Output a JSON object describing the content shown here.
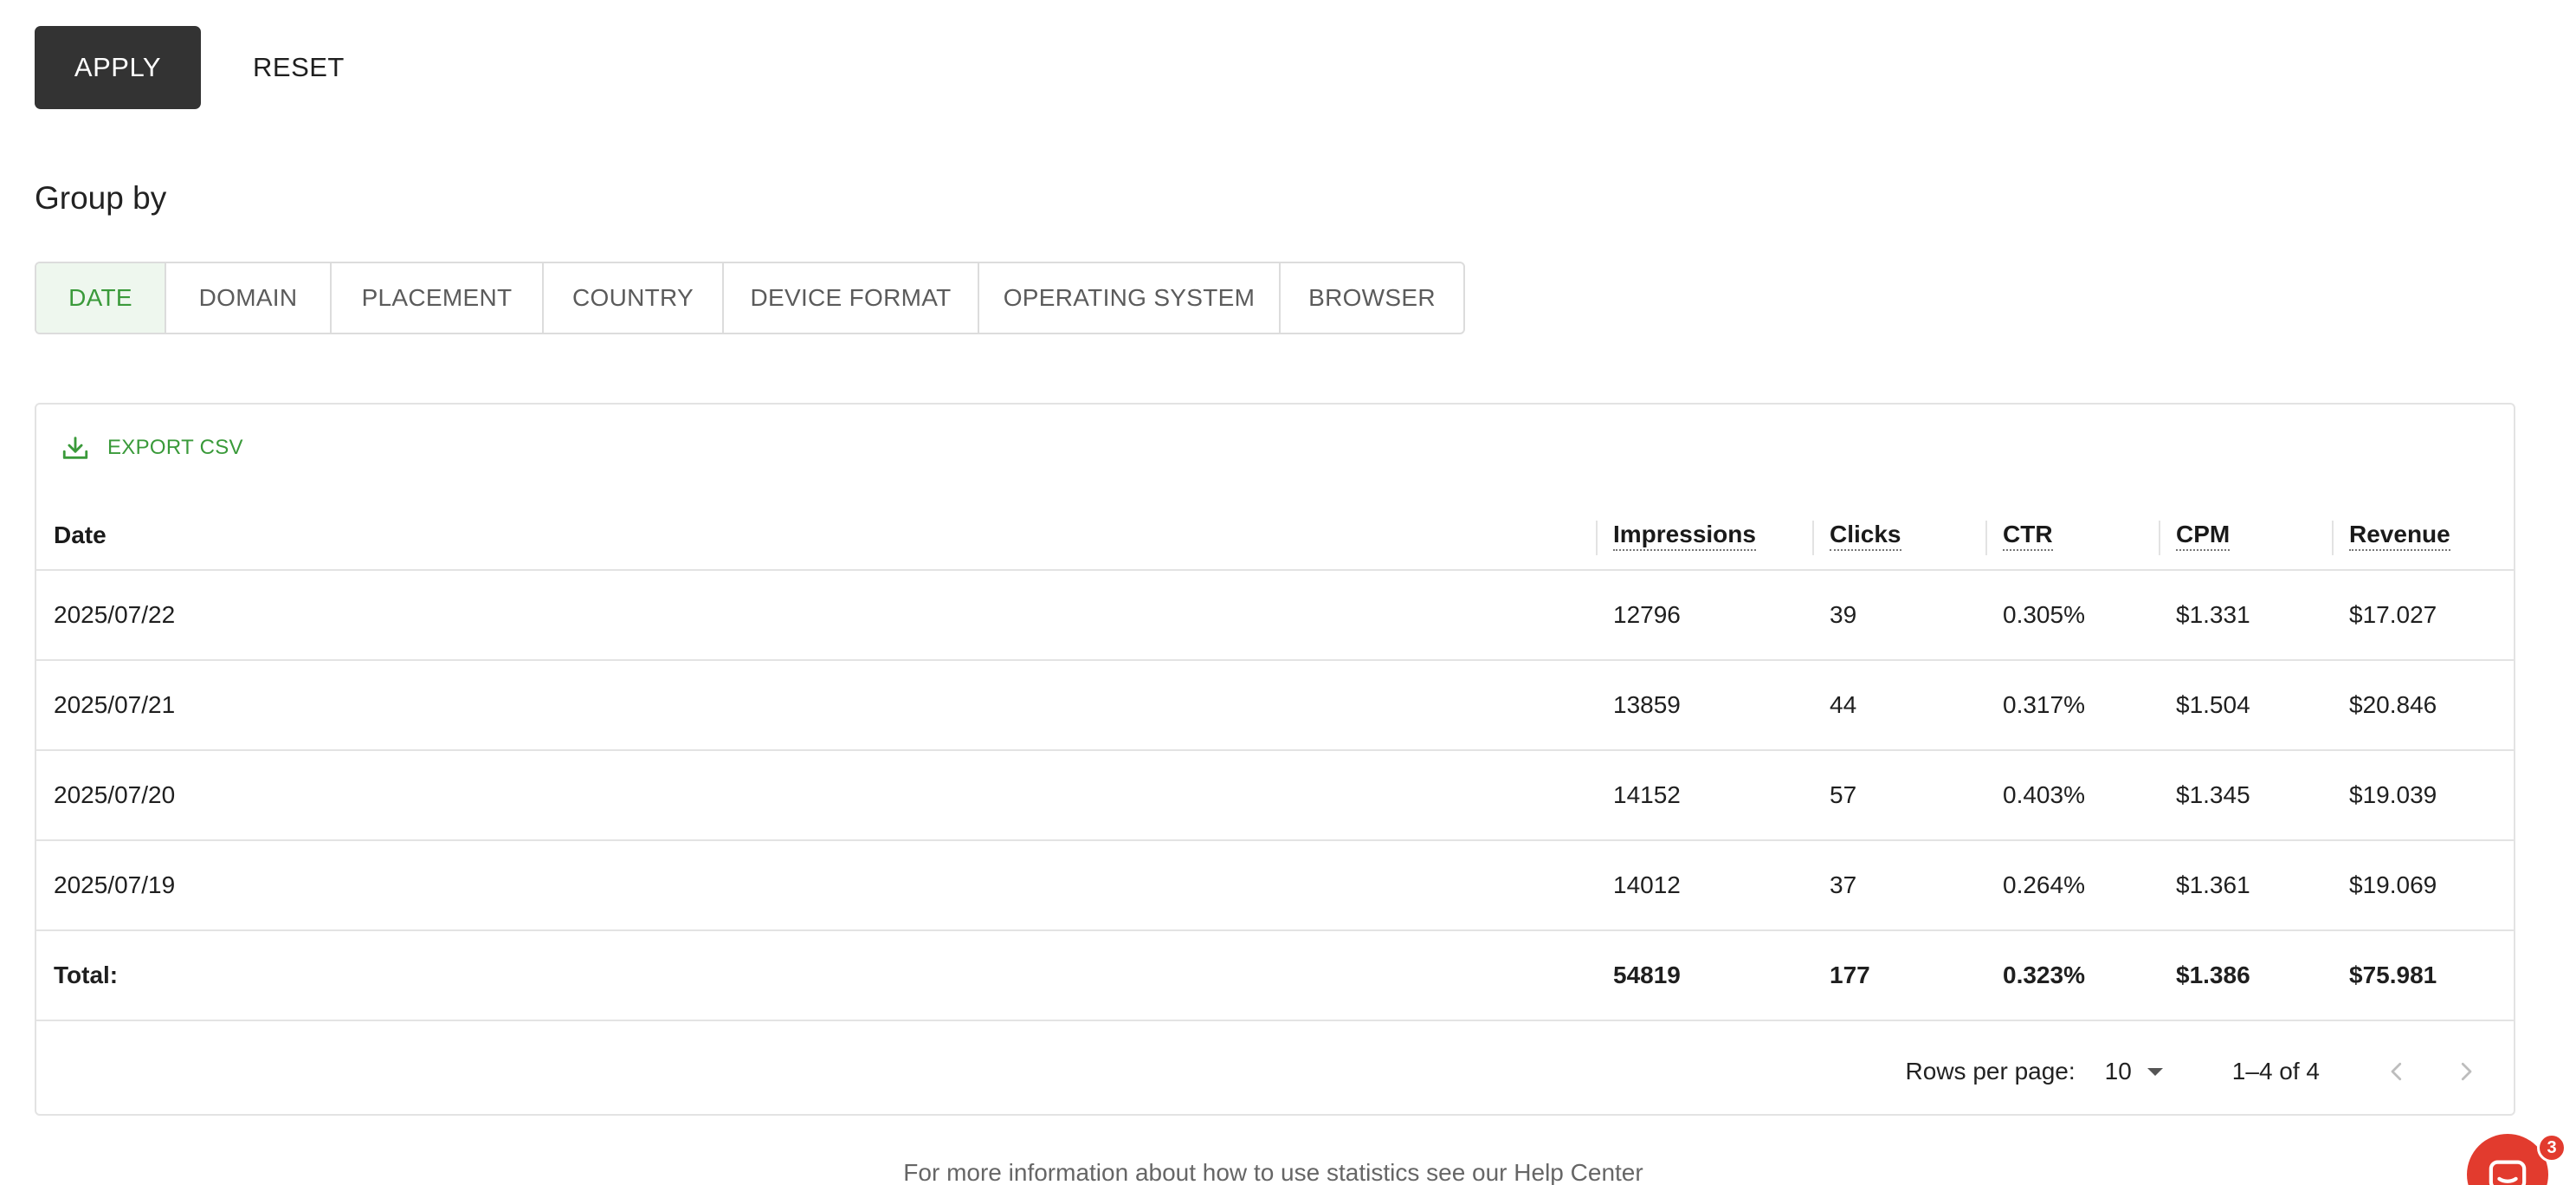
{
  "actions": {
    "apply_label": "APPLY",
    "reset_label": "RESET"
  },
  "group_by": {
    "title": "Group by",
    "tabs": [
      {
        "label": "DATE",
        "active": true
      },
      {
        "label": "DOMAIN"
      },
      {
        "label": "PLACEMENT"
      },
      {
        "label": "COUNTRY"
      },
      {
        "label": "DEVICE FORMAT"
      },
      {
        "label": "OPERATING SYSTEM"
      },
      {
        "label": "BROWSER"
      }
    ]
  },
  "table": {
    "export_label": "EXPORT CSV",
    "columns": [
      "Date",
      "Impressions",
      "Clicks",
      "CTR",
      "CPM",
      "Revenue"
    ],
    "rows": [
      [
        "2025/07/22",
        "12796",
        "39",
        "0.305%",
        "$1.331",
        "$17.027"
      ],
      [
        "2025/07/21",
        "13859",
        "44",
        "0.317%",
        "$1.504",
        "$20.846"
      ],
      [
        "2025/07/20",
        "14152",
        "57",
        "0.403%",
        "$1.345",
        "$19.039"
      ],
      [
        "2025/07/19",
        "14012",
        "37",
        "0.264%",
        "$1.361",
        "$19.069"
      ]
    ],
    "total": [
      "Total:",
      "54819",
      "177",
      "0.323%",
      "$1.386",
      "$75.981"
    ]
  },
  "pagination": {
    "rows_per_page_label": "Rows per page:",
    "rows_per_page_value": "10",
    "range": "1–4 of 4"
  },
  "footer": {
    "help_text": "For more information about how to use statistics see our Help Center"
  },
  "chat": {
    "badge_count": "3",
    "accent": "#e23b2e"
  },
  "colors": {
    "primary_dark": "#333333",
    "accent_green": "#3a9a3a"
  }
}
